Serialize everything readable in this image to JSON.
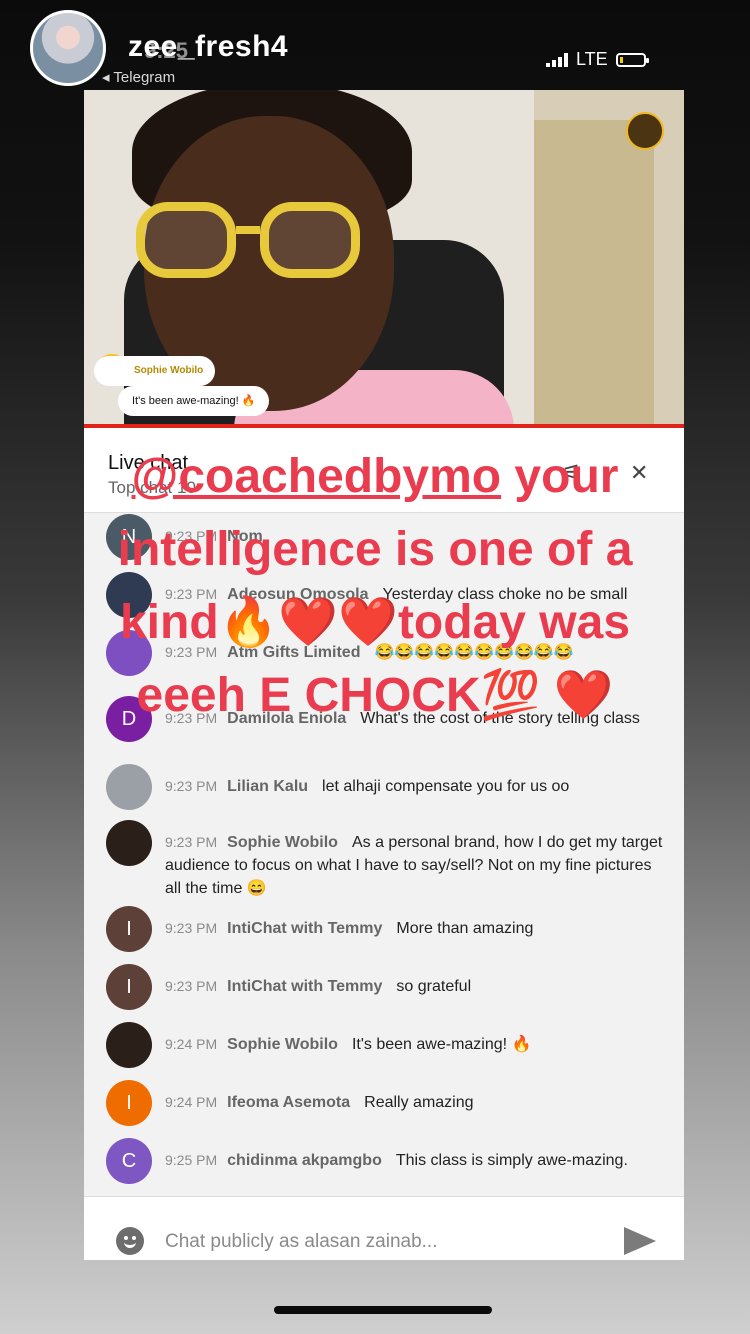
{
  "story": {
    "username": "zee_fresh4",
    "back_label": "◂ Telegram",
    "time": "9:25",
    "network": "LTE"
  },
  "video": {
    "overlay_name": "Sophie Wobilo",
    "overlay_message": "It's been awe-mazing! 🔥"
  },
  "chat": {
    "title": "Live chat",
    "subtitle": "Top chat",
    "count": "10",
    "messages": [
      {
        "time": "9:23 PM",
        "author": "Nom",
        "text": "",
        "initial": "N",
        "color": "#4a5a66"
      },
      {
        "time": "9:23 PM",
        "author": "Adeosun Omosola",
        "text": "Yesterday class choke no be small",
        "initial": "",
        "color": "#2f3b52"
      },
      {
        "time": "9:23 PM",
        "author": "Atm Gifts Limited",
        "text": "😂😂😂😂😂😂😂😂😂😂",
        "initial": "",
        "color": "#7e4fc1"
      },
      {
        "time": "9:23 PM",
        "author": "Damilola Eniola",
        "text": "What's the cost of the story telling class",
        "initial": "D",
        "color": "#7b1fa2"
      },
      {
        "time": "9:23 PM",
        "author": "Lilian Kalu",
        "text": "let alhaji compensate you for us oo",
        "initial": "",
        "color": "#9aa0a6"
      },
      {
        "time": "9:23 PM",
        "author": "Sophie Wobilo",
        "text": "As a personal brand, how I do get my target audience to focus on what I have to say/sell? Not on my fine pictures all the time 😄",
        "initial": "",
        "color": "#2b1f1a"
      },
      {
        "time": "9:23 PM",
        "author": "IntiChat with Temmy",
        "text": "More than amazing",
        "initial": "I",
        "color": "#5d4037"
      },
      {
        "time": "9:23 PM",
        "author": "IntiChat with Temmy",
        "text": "so grateful",
        "initial": "I",
        "color": "#5d4037"
      },
      {
        "time": "9:24 PM",
        "author": "Sophie Wobilo",
        "text": "It's been awe-mazing! 🔥",
        "initial": "",
        "color": "#2b1f1a"
      },
      {
        "time": "9:24 PM",
        "author": "Ifeoma Asemota",
        "text": "Really amazing",
        "initial": "I",
        "color": "#ef6c00"
      },
      {
        "time": "9:25 PM",
        "author": "chidinma akpamgbo",
        "text": "This class is simply awe-mazing.",
        "initial": "C",
        "color": "#7e57c2"
      }
    ]
  },
  "input": {
    "placeholder": "Chat publicly as alasan zainab..."
  },
  "sticker": {
    "mention": "@coachedbymo",
    "line1_rest": " your",
    "line2": "intelligence is one of a",
    "line3": "kind🔥❤️❤️today was",
    "line4": "eeeh E CHOCK💯 ❤️"
  }
}
